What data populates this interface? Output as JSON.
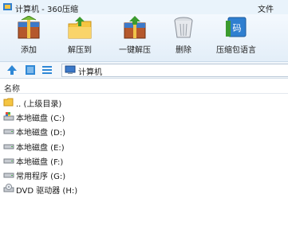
{
  "window": {
    "title": "计算机 - 360压缩",
    "menu_file": "文件"
  },
  "toolbar": {
    "add": "添加",
    "extract_to": "解压到",
    "one_click_extract": "一键解压",
    "delete": "删除",
    "compression_language": "压缩包语言"
  },
  "address": {
    "path": "计算机"
  },
  "columns": {
    "name": "名称"
  },
  "items": [
    {
      "label": ".. (上级目录)",
      "icon": "folder-up-icon"
    },
    {
      "label": "本地磁盘 (C:)",
      "icon": "system-drive-icon"
    },
    {
      "label": "本地磁盘 (D:)",
      "icon": "drive-icon"
    },
    {
      "label": "本地磁盘 (E:)",
      "icon": "drive-icon"
    },
    {
      "label": "本地磁盘 (F:)",
      "icon": "drive-icon"
    },
    {
      "label": "常用程序 (G:)",
      "icon": "drive-icon"
    },
    {
      "label": "DVD 驱动器 (H:)",
      "icon": "dvd-drive-icon"
    }
  ]
}
